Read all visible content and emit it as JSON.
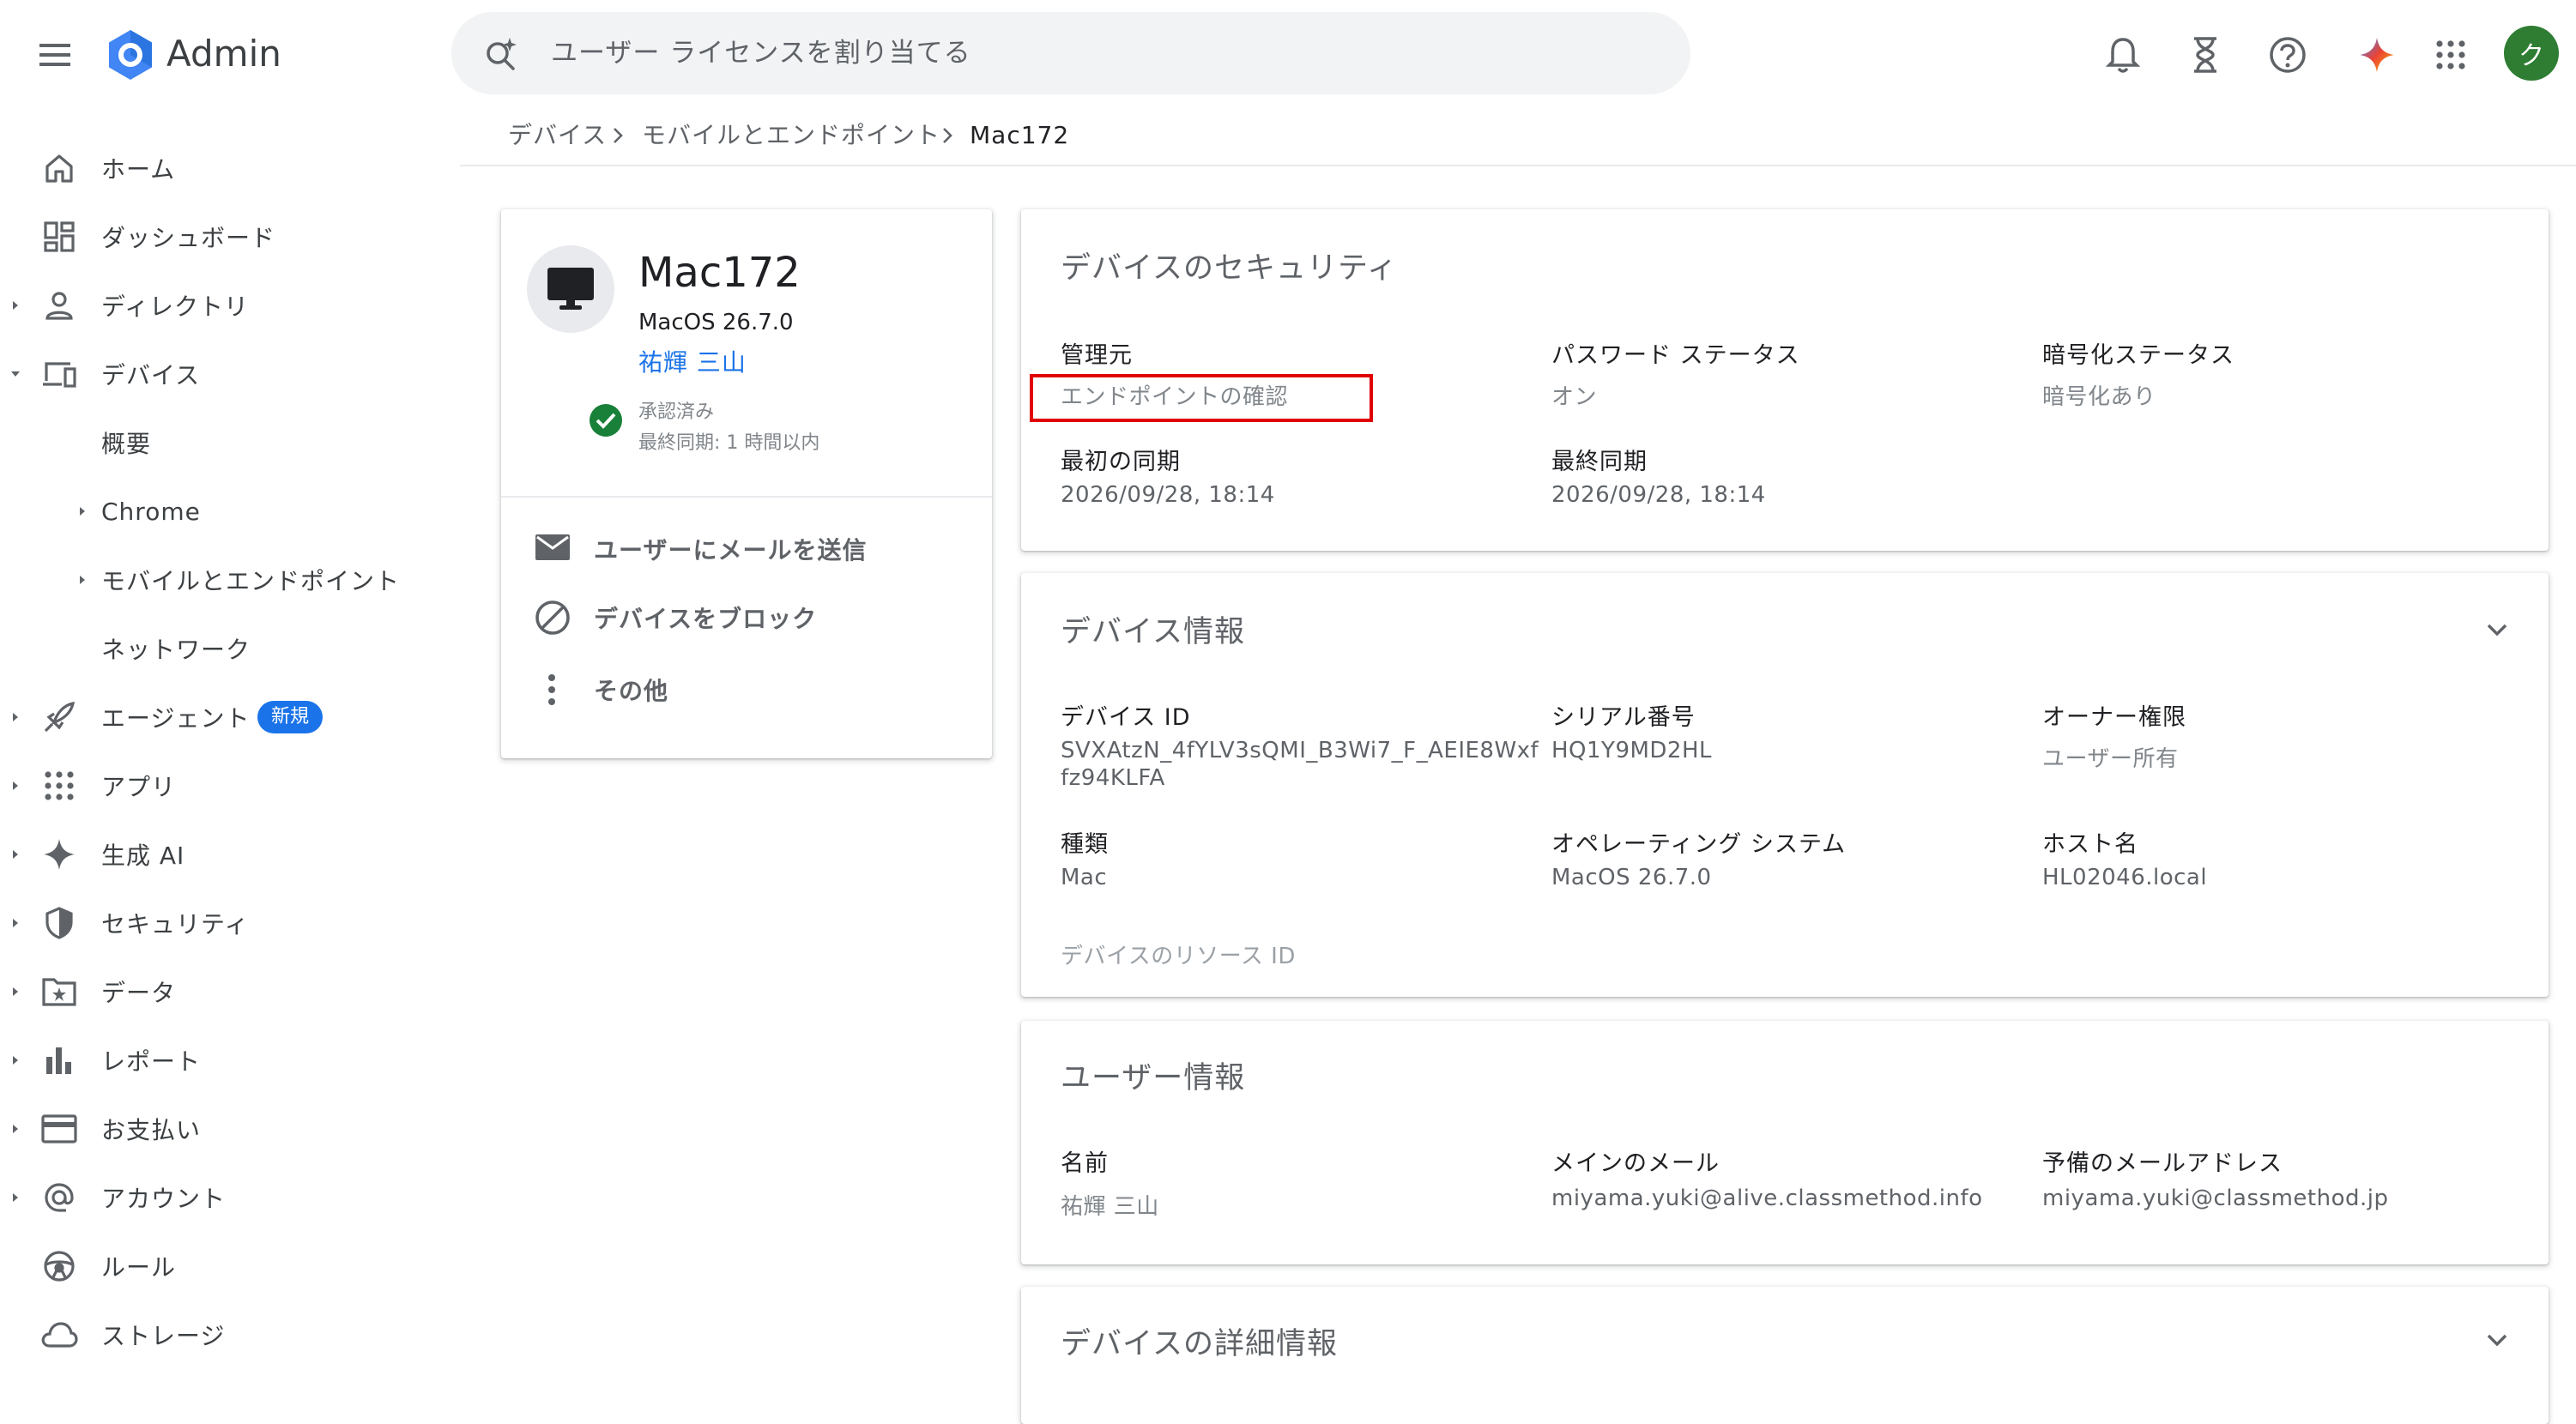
{
  "app": {
    "title": "Admin"
  },
  "search": {
    "placeholder": "ユーザー ライセンスを割り当てる"
  },
  "header": {
    "avatar_initial": "ク"
  },
  "sidebar": {
    "items": [
      {
        "label": "ホーム",
        "icon": "home-icon"
      },
      {
        "label": "ダッシュボード",
        "icon": "dashboard-icon"
      },
      {
        "label": "ディレクトリ",
        "icon": "person-icon"
      },
      {
        "label": "デバイス",
        "icon": "devices-icon"
      },
      {
        "label": "概要"
      },
      {
        "label": "Chrome"
      },
      {
        "label": "モバイルとエンドポイント"
      },
      {
        "label": "ネットワーク"
      },
      {
        "label": "エージェント",
        "icon": "rocket-icon",
        "badge": "新規"
      },
      {
        "label": "アプリ",
        "icon": "apps-grid-icon"
      },
      {
        "label": "生成 AI",
        "icon": "sparkle-icon"
      },
      {
        "label": "セキュリティ",
        "icon": "shield-icon"
      },
      {
        "label": "データ",
        "icon": "folder-star-icon"
      },
      {
        "label": "レポート",
        "icon": "bar-chart-icon"
      },
      {
        "label": "お支払い",
        "icon": "credit-card-icon"
      },
      {
        "label": "アカウント",
        "icon": "at-sign-icon"
      },
      {
        "label": "ルール",
        "icon": "steering-wheel-icon"
      },
      {
        "label": "ストレージ",
        "icon": "cloud-icon"
      }
    ]
  },
  "breadcrumb": {
    "items": [
      "デバイス",
      "モバイルとエンドポイント",
      "Mac172"
    ]
  },
  "device_card": {
    "name": "Mac172",
    "os": "MacOS 26.7.0",
    "user": "祐輝 三山",
    "status": "承認済み",
    "last_sync": "最終同期: 1 時間以内",
    "actions": [
      "ユーザーにメールを送信",
      "デバイスをブロック",
      "その他"
    ]
  },
  "security": {
    "title": "デバイスのセキュリティ",
    "fields": [
      {
        "label": "管理元",
        "value": "エンドポイントの確認"
      },
      {
        "label": "パスワード ステータス",
        "value": "オン"
      },
      {
        "label": "暗号化ステータス",
        "value": "暗号化あり"
      },
      {
        "label": "最初の同期",
        "value": "2026/09/28, 18:14"
      },
      {
        "label": "最終同期",
        "value": "2026/09/28, 18:14"
      }
    ],
    "highlight_color": "#e00000"
  },
  "device_info": {
    "title": "デバイス情報",
    "fields": [
      {
        "label": "デバイス ID",
        "value_line1": "SVXAtzN_4fYLV3sQMI_B3Wi7_F_AEIE8Wxf",
        "value_line2": "fz94KLFA"
      },
      {
        "label": "シリアル番号",
        "value": "HQ1Y9MD2HL"
      },
      {
        "label": "オーナー権限",
        "value": "ユーザー所有"
      },
      {
        "label": "種類",
        "value": "Mac"
      },
      {
        "label": "オペレーティング システム",
        "value": "MacOS 26.7.0"
      },
      {
        "label": "ホスト名",
        "value": "HL02046.local"
      }
    ],
    "resource_id_label": "デバイスのリソース ID"
  },
  "user_info": {
    "title": "ユーザー情報",
    "fields": [
      {
        "label": "名前",
        "value": "祐輝 三山"
      },
      {
        "label": "メインのメール",
        "value": "miyama.yuki@alive.classmethod.info"
      },
      {
        "label": "予備のメールアドレス",
        "value": "miyama.yuki@classmethod.jp"
      }
    ]
  },
  "details": {
    "title": "デバイスの詳細情報"
  },
  "colors": {
    "link": "#1a73e8",
    "success": "#188038",
    "avatar": "#2e7d32"
  }
}
